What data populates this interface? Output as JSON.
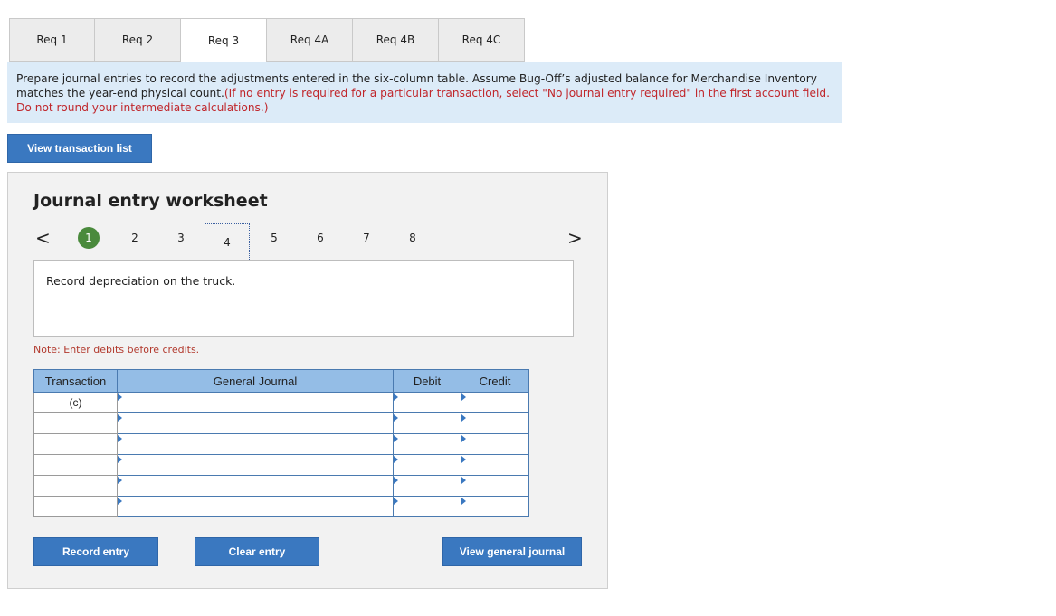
{
  "tabs": [
    {
      "label": "Req 1"
    },
    {
      "label": "Req 2"
    },
    {
      "label": "Req 3"
    },
    {
      "label": "Req 4A"
    },
    {
      "label": "Req 4B"
    },
    {
      "label": "Req 4C"
    }
  ],
  "active_tab": "Req 3",
  "instructions": {
    "main": "Prepare journal entries to record the adjustments entered in the six-column table. Assume Bug-Off’s adjusted balance for Merchandise Inventory matches the year-end physical count.",
    "note": "(If no entry is required for a particular transaction, select \"No journal entry required\" in the first account field. Do not round your intermediate calculations.)"
  },
  "view_transaction_list_label": "View transaction list",
  "worksheet": {
    "title": "Journal entry worksheet",
    "prev_arrow": "<",
    "next_arrow": ">",
    "pages": [
      "1",
      "2",
      "3",
      "4",
      "5",
      "6",
      "7",
      "8"
    ],
    "completed_page": "1",
    "current_page": "4",
    "description": "Record depreciation on the truck.",
    "note": "Note: Enter debits before credits.",
    "columns": {
      "transaction": "Transaction",
      "general_journal": "General Journal",
      "debit": "Debit",
      "credit": "Credit"
    },
    "transaction_label": "(c)",
    "rows": 6,
    "record_entry_label": "Record entry",
    "clear_entry_label": "Clear entry",
    "view_general_journal_label": "View general journal"
  },
  "colors": {
    "accent": "#3a78c0",
    "instruction_bg": "#dcebf8",
    "header_bg": "#94bde6",
    "completed": "#4a8a3c",
    "instruction_red": "#c0262b"
  }
}
